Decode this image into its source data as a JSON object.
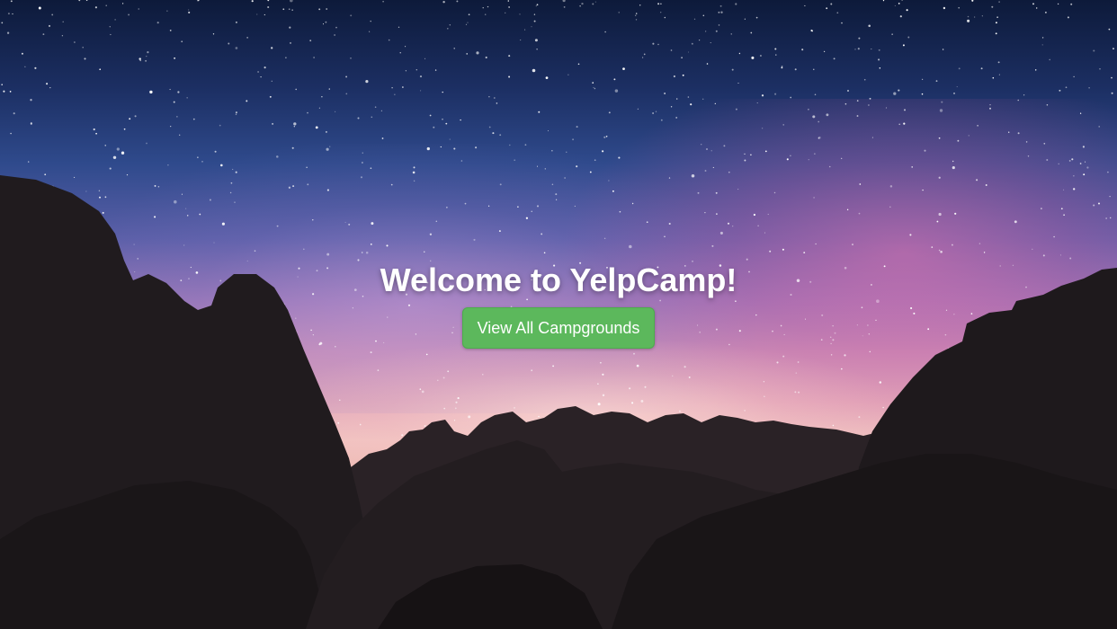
{
  "hero": {
    "title": "Welcome to YelpCamp!",
    "button_label": "View All Campgrounds"
  },
  "colors": {
    "button_bg": "#5cb85c",
    "button_border": "#4cae4c",
    "title_text": "#ffffff"
  }
}
